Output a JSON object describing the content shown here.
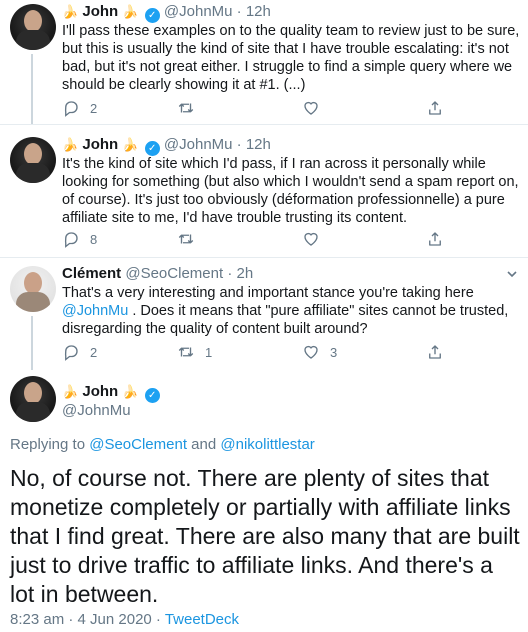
{
  "tweets": [
    {
      "name": "John",
      "handle": "@JohnMu",
      "time": "12h",
      "text": "I'll pass these examples on to the quality team to review just to be sure, but this is usually the kind of site that I have trouble escalating: it's not bad, but it's not great either. I struggle to find a simple query where we should be clearly showing it at #1. (...)",
      "replies": "2",
      "retweets": "",
      "likes": ""
    },
    {
      "name": "John",
      "handle": "@JohnMu",
      "time": "12h",
      "text": "It's the kind of site which I'd pass, if I ran across it personally while looking for something (but also which I wouldn't send a spam report on, of course). It's just too obviously (déformation professionnelle) a pure affiliate site to me, I'd have trouble trusting its content.",
      "replies": "8",
      "retweets": "",
      "likes": ""
    },
    {
      "name": "Clément",
      "handle": "@SeoClement",
      "time": "2h",
      "text_before": "That's a very interesting and important stance you're taking here ",
      "mention": "@JohnMu",
      "text_after": " . Does it means that \"pure affiliate\" sites cannot be trusted, disregarding the quality of content built around?",
      "replies": "2",
      "retweets": "1",
      "likes": "3"
    }
  ],
  "main_tweet": {
    "name": "John",
    "handle": "@JohnMu",
    "replying_label": "Replying to ",
    "replying_user1": "@SeoClement",
    "replying_and": " and ",
    "replying_user2": "@nikolittlestar",
    "text": "No, of course not. There are plenty of sites that monetize completely or partially with affiliate links that I find great. There are also many that are built just to drive traffic to affiliate links. And there's a lot in between.",
    "timestamp": "8:23 am · 4 Jun 2020 · ",
    "source": "TweetDeck"
  },
  "icons": {
    "reply": "reply-icon",
    "retweet": "retweet-icon",
    "like": "heart-icon",
    "share": "share-icon",
    "verified": "verified-icon",
    "more": "chevron-down-icon"
  },
  "colors": {
    "accent": "#1da1f2",
    "link": "#1b95e0",
    "muted": "#657786",
    "divider": "#e6ecf0"
  }
}
